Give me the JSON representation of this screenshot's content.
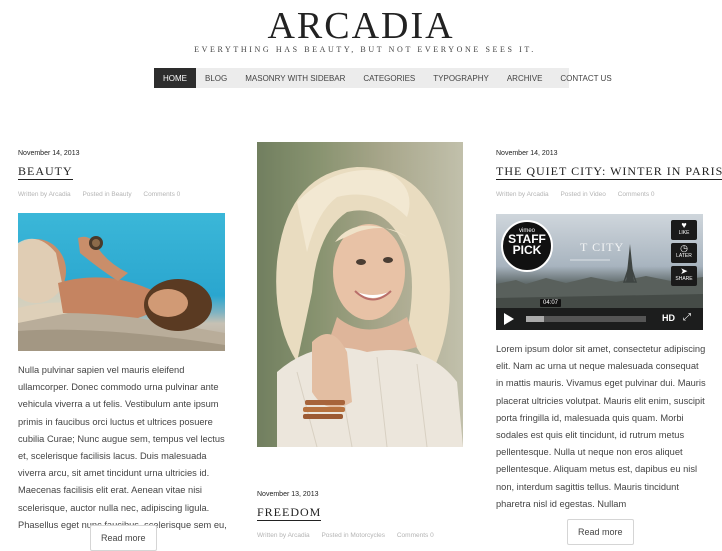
{
  "site": {
    "title": "ARCADIA",
    "tagline": "EVERYTHING HAS BEAUTY, BUT NOT EVERYONE SEES IT."
  },
  "nav": {
    "items": [
      "HOME",
      "BLOG",
      "MASONRY WITH SIDEBAR",
      "CATEGORIES",
      "TYPOGRAPHY",
      "ARCHIVE",
      "CONTACT US"
    ],
    "active": "HOME"
  },
  "posts": {
    "beauty": {
      "date": "November 14, 2013",
      "title": "BEAUTY",
      "author": "Written by Arcadia",
      "category": "Posted in Beauty",
      "comments": "Comments 0",
      "excerpt": "Nulla pulvinar sapien vel mauris eleifend ullamcorper. Donec commodo urna pulvinar ante vehicula viverra a ut felis. Vestibulum ante ipsum primis in faucibus orci luctus et ultrices posuere cubilia Curae; Nunc augue sem, tempus vel lectus et, scelerisque facilisis lacus. Duis malesuada viverra arcu, sit amet tincidunt urna ultricies id. Maecenas facilisis elit erat. Aenean vitae nisi scelerisque, auctor nulla nec, adipiscing ligula. Phasellus eget nunc faucibus, scelerisque sem eu,",
      "read_more": "Read more"
    },
    "freedom": {
      "date": "November 13, 2013",
      "title": "FREEDOM",
      "author": "Written by Arcadia",
      "category": "Posted in Motorcycles",
      "comments": "Comments 0"
    },
    "paris": {
      "date": "November 14, 2013",
      "title": "THE QUIET CITY: WINTER IN PARIS",
      "author": "Written by Arcadia",
      "category": "Posted in Video",
      "comments": "Comments 0",
      "excerpt": "Lorem ipsum dolor sit amet, consectetur adipiscing elit. Nam ac urna ut neque malesuada consequat in mattis mauris. Vivamus eget pulvinar dui. Mauris placerat ultricies volutpat. Mauris elit enim, suscipit porta fringilla id, malesuada quis quam. Morbi sodales est quis elit tincidunt, id rutrum metus pellentesque. Nulla ut neque non eros aliquet pellentesque. Aliquam metus est, dapibus eu nisl non, interdum sagittis tellus. Mauris tincidunt pharetra nisl id egestas. Nullam",
      "read_more": "Read more"
    }
  },
  "video": {
    "badge_small": "vimeo",
    "badge_big_1": "STAFF",
    "badge_big_2": "PICK",
    "city_text": "T CITY",
    "time": "04:07",
    "like": "LIKE",
    "later": "LATER",
    "share": "SHARE",
    "hd": "HD"
  },
  "colors": {
    "nav_active_bg": "#2d2d2d",
    "nav_bg": "#ececec",
    "meta_text": "#b4b4b4"
  }
}
